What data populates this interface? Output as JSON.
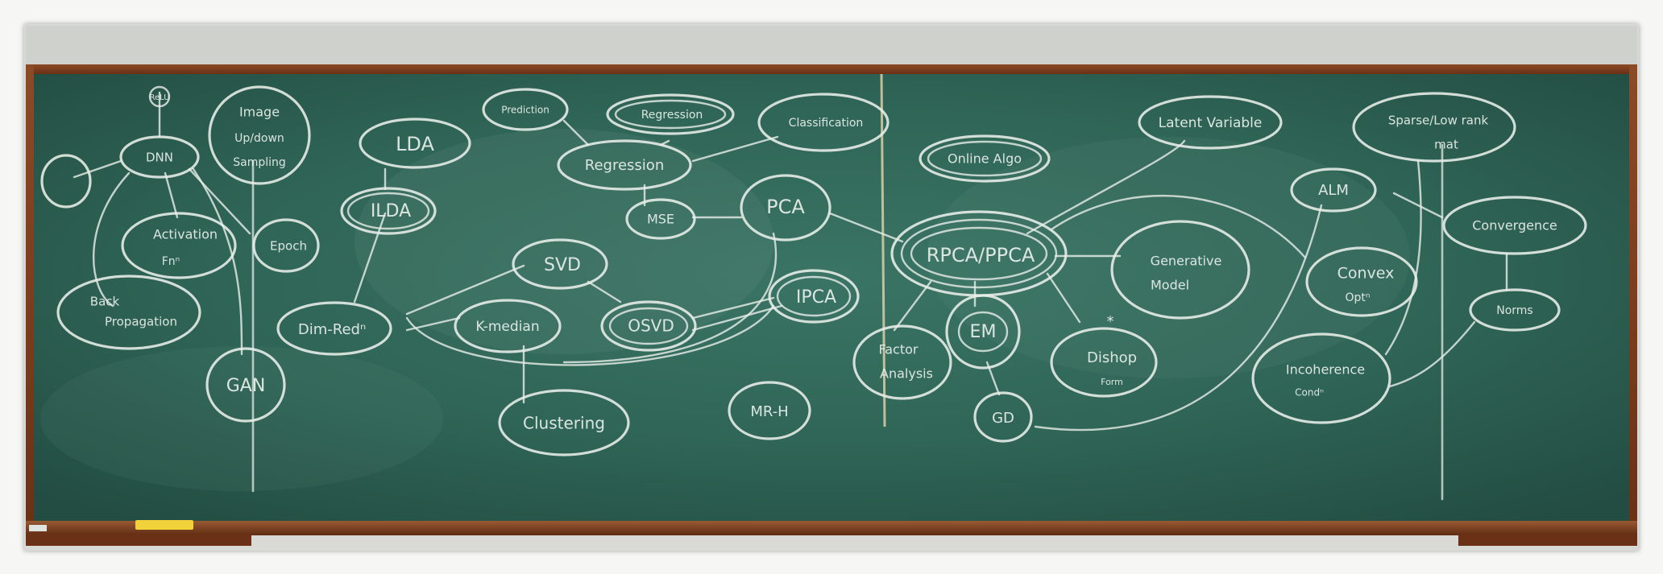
{
  "board": {
    "color": "#2b5e50",
    "frame_color": "#7a3b1f",
    "chalk_color": "#e9efe9",
    "tray_chalk_color": "#f2d23a"
  },
  "nodes": {
    "relu": "ReLU",
    "dnn": "DNN",
    "image_up_down_sampling": [
      "Image",
      "Up/down",
      "Sampling"
    ],
    "lda": "LDA",
    "ilda": "ILDA",
    "prediction": "Prediction",
    "regression_top": "Regression",
    "regression": "Regression",
    "classification": "Classification",
    "mse": "MSE",
    "pca": "PCA",
    "activation_fn": [
      "Activation",
      "Fnⁿ"
    ],
    "epoch": "Epoch",
    "back_propagation": [
      "Back",
      "Propagation"
    ],
    "svd": "SVD",
    "dim_red": "Dim-Redⁿ",
    "k_median": "K-median",
    "osvd": "OSVD",
    "ipca": "IPCA",
    "gan": "GAN",
    "clustering": "Clustering",
    "mr_h": "MR-H",
    "online_algo": "Online Algo",
    "rpca_ppca": "RPCA/PPCA",
    "latent_variable": "Latent Variable",
    "generative_model": [
      "Generative",
      "Model"
    ],
    "em": "EM",
    "factor_analysis": [
      "Factor",
      "Analysis"
    ],
    "dishop_form": [
      "Dishop",
      "Form"
    ],
    "gd": "GD",
    "sparse_low_rank": [
      "Sparse/Low rank",
      "mat"
    ],
    "alm": "ALM",
    "convergence": "Convergence",
    "convex_opt": [
      "Convex",
      "Optⁿ"
    ],
    "norms": "Norms",
    "incoherence_condn": [
      "Incoherence",
      "Condⁿ"
    ]
  }
}
